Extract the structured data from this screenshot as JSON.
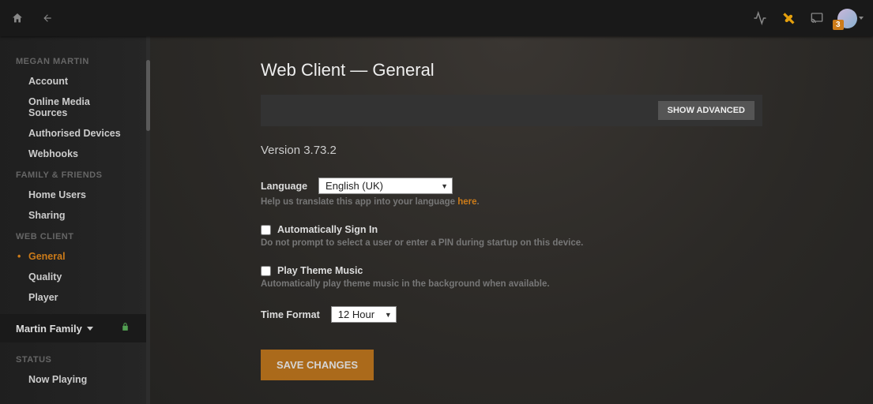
{
  "topbar": {
    "badge_count": "3"
  },
  "sidebar": {
    "sections": [
      {
        "title": "MEGAN MARTIN",
        "items": [
          "Account",
          "Online Media Sources",
          "Authorised Devices",
          "Webhooks"
        ],
        "active": -1
      },
      {
        "title": "FAMILY & FRIENDS",
        "items": [
          "Home Users",
          "Sharing"
        ],
        "active": -1
      },
      {
        "title": "WEB CLIENT",
        "items": [
          "General",
          "Quality",
          "Player"
        ],
        "active": 0
      }
    ],
    "server_name": "Martin Family",
    "status": {
      "title": "STATUS",
      "items": [
        "Now Playing"
      ]
    }
  },
  "main": {
    "title": "Web Client — General",
    "show_advanced": "SHOW ADVANCED",
    "version": "Version 3.73.2",
    "language_label": "Language",
    "language_value": "English (UK)",
    "translate_hint_pre": "Help us translate this app into your language ",
    "translate_hint_link": "here",
    "translate_hint_post": ".",
    "auto_signin_label": "Automatically Sign In",
    "auto_signin_hint": "Do not prompt to select a user or enter a PIN during startup on this device.",
    "theme_label": "Play Theme Music",
    "theme_hint": "Automatically play theme music in the background when available.",
    "time_label": "Time Format",
    "time_value": "12 Hour",
    "save": "SAVE CHANGES"
  }
}
